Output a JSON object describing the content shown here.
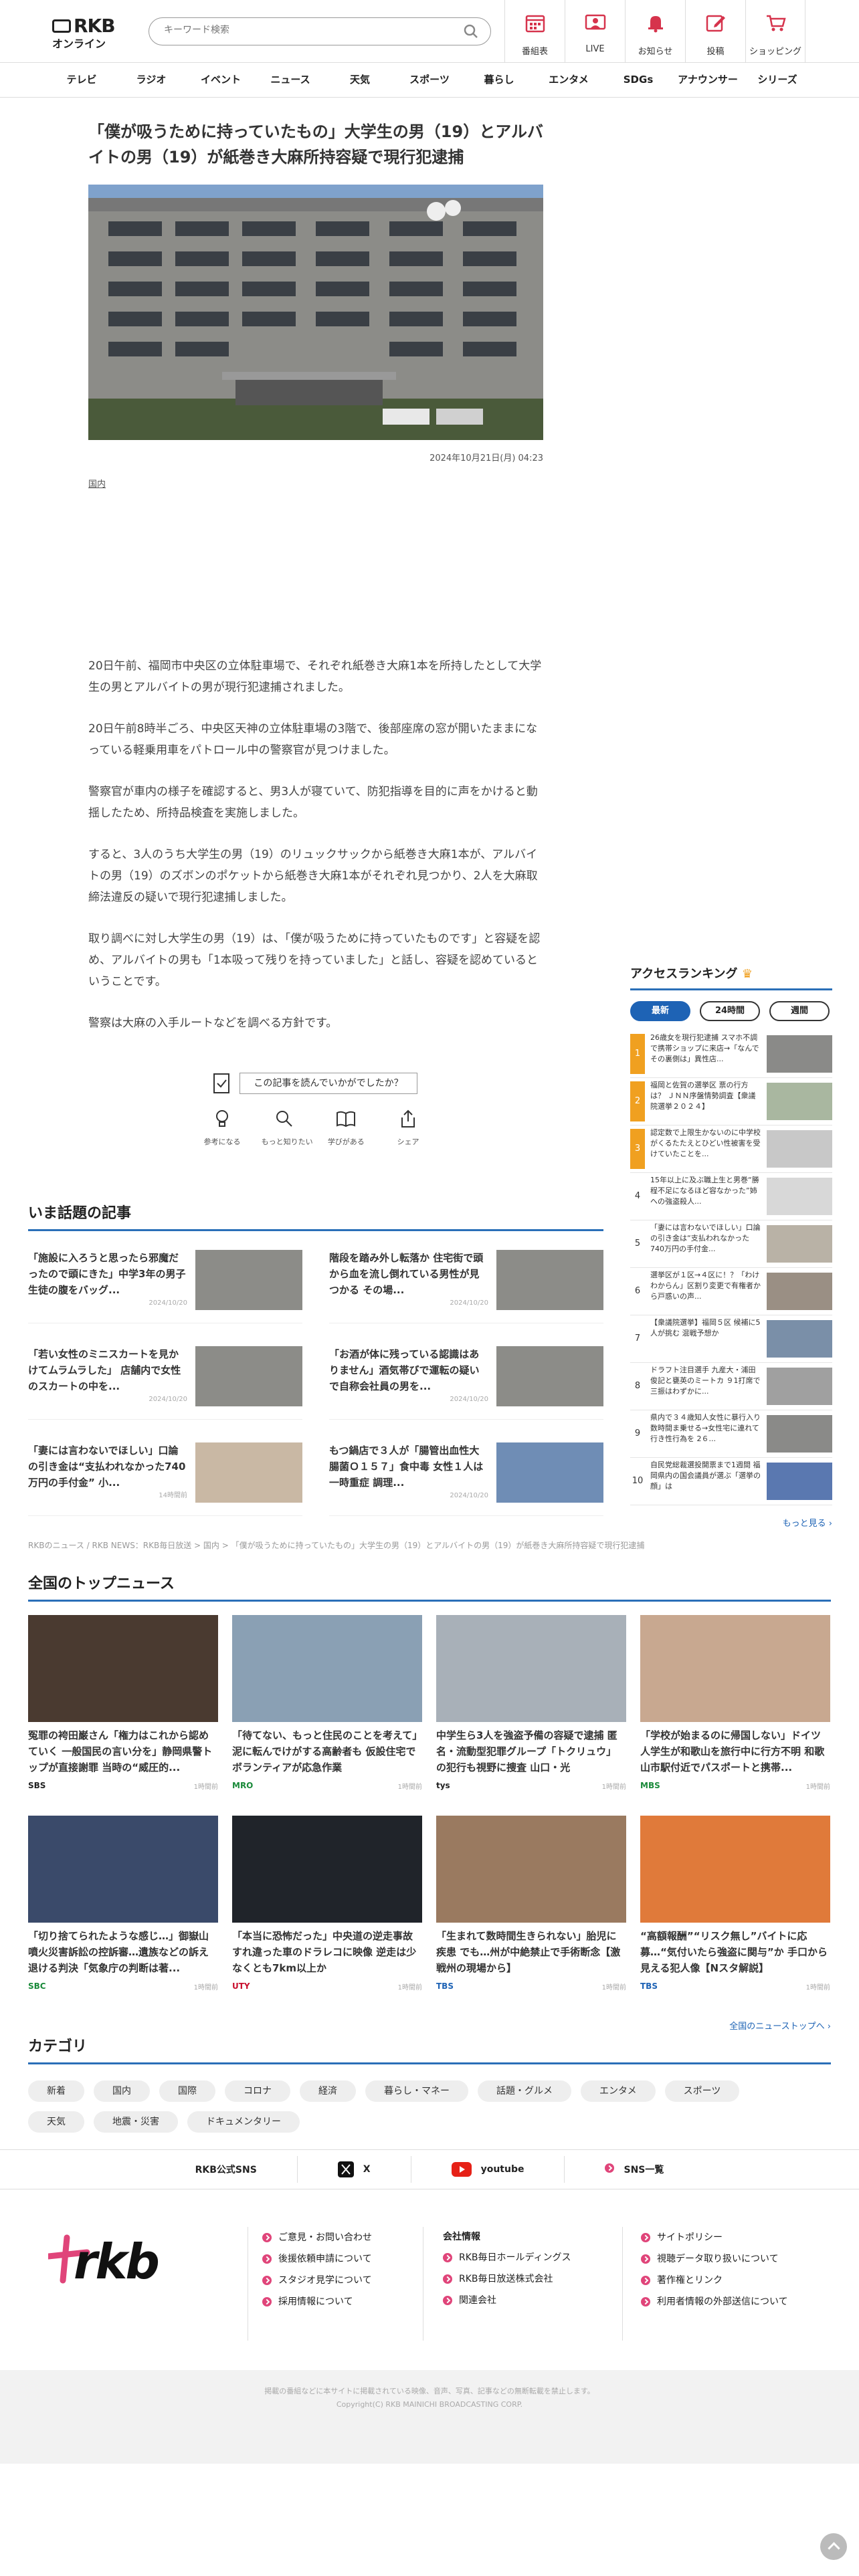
{
  "header": {
    "logo_top": "RKB",
    "logo_bottom": "オンライン",
    "search_placeholder": "キーワード検索",
    "nav": [
      "番組表",
      "LIVE",
      "お知らせ",
      "投稿",
      "ショッピング"
    ]
  },
  "global_nav": [
    "テレビ",
    "ラジオ",
    "イベント",
    "ニュース",
    "天気",
    "スポーツ",
    "暮らし",
    "エンタメ",
    "SDGs",
    "アナウンサー",
    "シリーズ"
  ],
  "article": {
    "title": "「僕が吸うために持っていたもの」大学生の男（19）とアルバイトの男（19）が紙巻き大麻所持容疑で現行犯逮捕",
    "date": "2024年10月21日(月) 04:23",
    "category": "国内",
    "paragraphs": [
      "20日午前、福岡市中央区の立体駐車場で、それぞれ紙巻き大麻1本を所持したとして大学生の男とアルバイトの男が現行犯逮捕されました。",
      "20日午前8時半ごろ、中央区天神の立体駐車場の3階で、後部座席の窓が開いたままになっている軽乗用車をパトロール中の警察官が見つけました。",
      "警察官が車内の様子を確認すると、男3人が寝ていて、防犯指導を目的に声をかけると動揺したため、所持品検査を実施しました。",
      "すると、3人のうち大学生の男（19）のリュックサックから紙巻き大麻1本が、アルバイトの男（19）のズボンのポケットから紙巻き大麻1本がそれぞれ見つかり、2人を大麻取締法違反の疑いで現行犯逮捕しました。",
      "取り調べに対し大学生の男（19）は、「僕が吸うために持っていたものです」と容疑を認め、アルバイトの男も「1本吸って残りを持っていました」と話し、容疑を認めているということです。",
      "警察は大麻の入手ルートなどを調べる方針です。"
    ]
  },
  "feedback": {
    "question": "この記事を読んでいかがでしたか？",
    "buttons": [
      "参考になる",
      "もっと知りたい",
      "学びがある",
      "シェア"
    ]
  },
  "ranking": {
    "title": "アクセスランキング",
    "tabs": [
      "最新",
      "24時間",
      "週間"
    ],
    "items": [
      {
        "rank": "1",
        "text": "26歳女を現行犯逮捕 スマホ不調で携帯ショップに来店→「なんでその裏側は」異性店..."
      },
      {
        "rank": "2",
        "text": "福岡と佐賀の選挙区 票の行方は？ ＪＮＮ序盤情勢調査【衆議院選挙２０２４】"
      },
      {
        "rank": "3",
        "text": "認定数で上限生かないのに中学校がくるたたえとひどい性被害を受けていたことを..."
      },
      {
        "rank": "4",
        "text": "15年以上に及ぶ職上生と男巻“勝程不足になるほど容なかった”姉への強盗殺人..."
      },
      {
        "rank": "5",
        "text": "「妻には言わないでほしい」口論の引き金は“支払われなかった740万円の手付金..."
      },
      {
        "rank": "6",
        "text": "選挙区が１区→４区に！？「わけわからん」区割り変更で有権者から戸惑いの声..."
      },
      {
        "rank": "7",
        "text": "【衆議院選挙】福岡５区 候補に5人が挑む 混戦予想か"
      },
      {
        "rank": "8",
        "text": "ドラフト注目選手 九産大・浦田 俊記と甕英のミートカ ９1打席で三振はわずかに..."
      },
      {
        "rank": "9",
        "text": "県内で３４歳知人女性に暴行入り数時間ま乗せる→女性宅に連れて行き性行為を 2６..."
      },
      {
        "rank": "10",
        "text": "自民党総裁選投開票まで1週間 福岡県内の国会議員が選ぶ「選挙の顔」は"
      }
    ],
    "more": "もっと見る"
  },
  "topics": {
    "title": "いま話題の記事",
    "items": [
      {
        "title": "「施設に入ろうと思ったら邪魔だったので頭にきた」中学3年の男子生徒の腹をバッグ...",
        "date": "2024/10/20"
      },
      {
        "title": "階段を踏み外し転落か 住宅街で頭から血を流し倒れている男性が見つかる その場...",
        "date": "2024/10/20"
      },
      {
        "title": "「若い女性のミニスカートを見かけてムラムラした」 店舗内で女性のスカートの中を...",
        "date": "2024/10/20"
      },
      {
        "title": "「お酒が体に残っている認識はありません」酒気帯びで運転の疑いで自称会社員の男を...",
        "date": "2024/10/20"
      },
      {
        "title": "「妻には言わないでほしい」口論の引き金は“支払われなかった740万円の手付金” 小...",
        "date": "14時間前"
      },
      {
        "title": "もつ鍋店で３人が「腸管出血性大腸菌Ｏ１５７」食中毒 女性１人は一時重症 調理...",
        "date": "2024/10/20"
      }
    ]
  },
  "breadcrumb": "RKBのニュース / RKB NEWS：RKB毎日放送 > 国内 > 「僕が吸うために持っていたもの」大学生の男（19）とアルバイトの男（19）が紙巻き大麻所持容疑で現行犯逮捕",
  "national": {
    "title": "全国のトップニュース",
    "items": [
      {
        "title": "冤罪の袴田巌さん「権力はこれから認めていく 一般国民の言い分を」静岡県警トップが直接謝罪 当時の“威圧的...",
        "source": "SBS",
        "time": "1時間前",
        "color": "#222"
      },
      {
        "title": "「待てない、もっと住民のことを考えて」泥に転んでけがする高齢者も 仮設住宅でボランティアが応急作業",
        "source": "MRO",
        "time": "1時間前",
        "color": "#1a8a3a"
      },
      {
        "title": "中学生ら3人を強盗予備の容疑で逮捕 匿名・流動型犯罪グループ「トクリュウ」の犯行も視野に捜査 山口・光",
        "source": "tys",
        "time": "1時間前",
        "color": "#222"
      },
      {
        "title": "「学校が始まるのに帰国しない」ドイツ人学生が和歌山を旅行中に行方不明 和歌山市駅付近でパスポートと携帯...",
        "source": "MBS",
        "time": "1時間前",
        "color": "#1a8a3a"
      },
      {
        "title": "「切り捨てられたような感じ…」御嶽山噴火災害訴訟の控訴審…遺族などの訴え退ける判決「気象庁の判断は著...",
        "source": "SBC",
        "time": "1時間前",
        "color": "#1a8a3a"
      },
      {
        "title": "「本当に恐怖だった」中央道の逆走事故 すれ違った車のドラレコに映像 逆走は少なくとも7km以上か",
        "source": "UTY",
        "time": "1時間前",
        "color": "#c8102e"
      },
      {
        "title": "「生まれて数時間生きられない」胎児に疾患 でも…州が中絶禁止で手術断念【激戦州の現場から】",
        "source": "TBS",
        "time": "1時間前",
        "color": "#1e63b5"
      },
      {
        "title": "“高額報酬”“リスク無し”バイトに応募…“気付いたら強盗に関与”か 手口から見える犯人像【Nスタ解説】",
        "source": "TBS",
        "time": "1時間前",
        "color": "#1e63b5"
      }
    ],
    "more": "全国のニューストップへ"
  },
  "categories": {
    "title": "カテゴリ",
    "items": [
      "新着",
      "国内",
      "国際",
      "コロナ",
      "経済",
      "暮らし・マネー",
      "話題・グルメ",
      "エンタメ",
      "スポーツ",
      "天気",
      "地震・災害",
      "ドキュメンタリー"
    ]
  },
  "sns": {
    "label": "RKB公式SNS",
    "items": [
      "X",
      "youtube",
      "SNS一覧"
    ]
  },
  "footer": {
    "logo": "rkb",
    "col1": [
      "ご意見・お問い合わせ",
      "後援依頼申請について",
      "スタジオ見学について",
      "採用情報について"
    ],
    "col2_title": "会社情報",
    "col2": [
      "RKB毎日ホールディングス",
      "RKB毎日放送株式会社",
      "関連会社"
    ],
    "col3": [
      "サイトポリシー",
      "視聴データ取り扱いについて",
      "著作権とリンク",
      "利用者情報の外部送信について"
    ],
    "copy1": "掲載の番組などに本サイトに掲載されている映像、音声、写真、記事などの無断転載を禁止します。",
    "copy2": "Copyright(C) RKB MAINICHI BROADCASTING CORP."
  },
  "colors": {
    "accent": "#2a6fb8",
    "brand_pink": "#e0457a",
    "nav_red": "#d6334c"
  }
}
